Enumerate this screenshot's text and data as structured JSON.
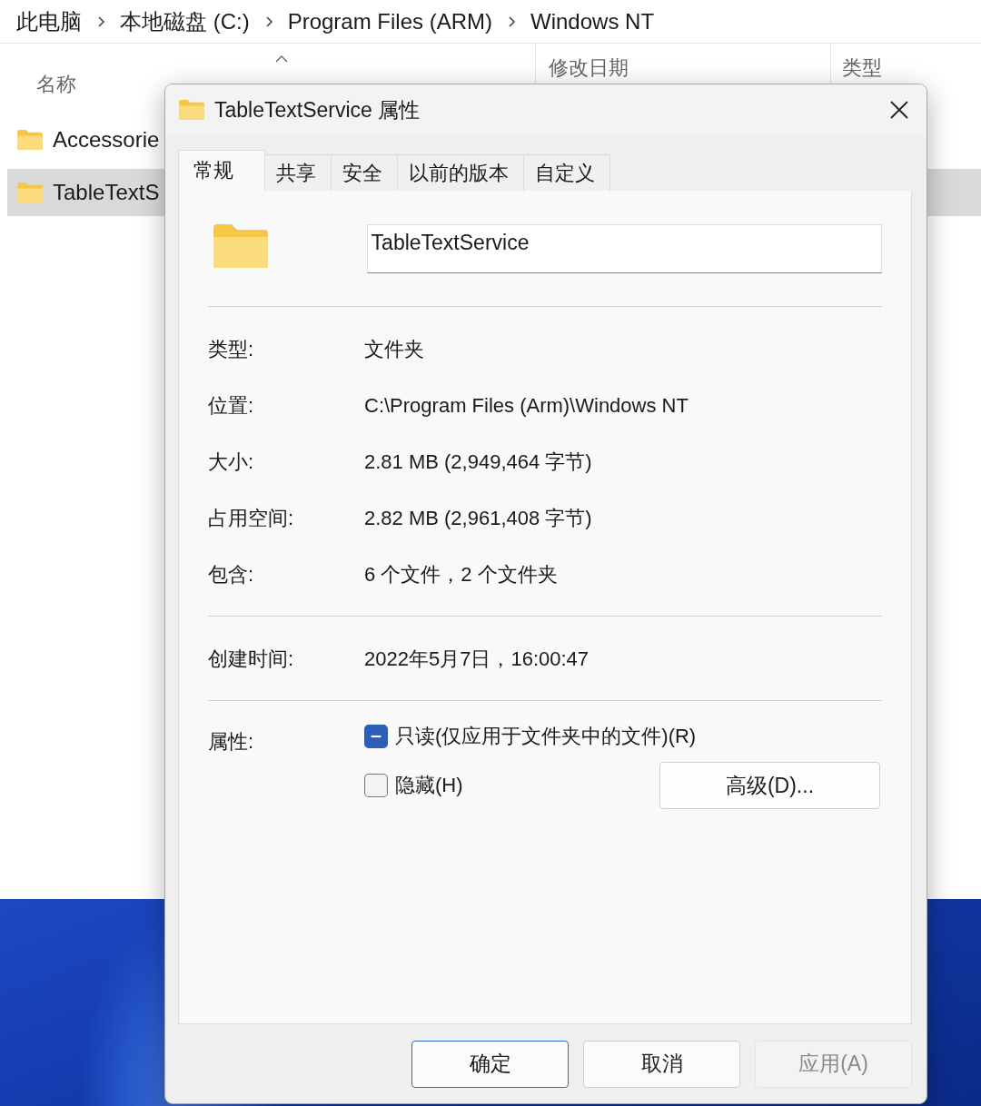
{
  "explorer": {
    "breadcrumb": [
      "此电脑",
      "本地磁盘 (C:)",
      "Program Files (ARM)",
      "Windows NT"
    ],
    "columns": [
      "名称",
      "修改日期",
      "类型"
    ],
    "rows": [
      {
        "name": "Accessorie",
        "selected": false
      },
      {
        "name": "TableTextS",
        "selected": true
      }
    ]
  },
  "dialog": {
    "title": "TableTextService 属性",
    "tabs": [
      {
        "label": "常规",
        "selected": true
      },
      {
        "label": "共享",
        "selected": false
      },
      {
        "label": "安全",
        "selected": false
      },
      {
        "label": "以前的版本",
        "selected": false
      },
      {
        "label": "自定义",
        "selected": false
      }
    ],
    "name_field": {
      "value": "TableTextService"
    },
    "properties": [
      {
        "label": "类型:",
        "value": "文件夹"
      },
      {
        "label": "位置:",
        "value": "C:\\Program Files (Arm)\\Windows NT"
      },
      {
        "label": "大小:",
        "value": "2.81 MB (2,949,464 字节)"
      },
      {
        "label": "占用空间:",
        "value": "2.82 MB (2,961,408 字节)"
      },
      {
        "label": "包含:",
        "value": "6 个文件，2 个文件夹"
      }
    ],
    "created": {
      "label": "创建时间:",
      "value": "2022年5月7日，16:00:47"
    },
    "attributes": {
      "label": "属性:",
      "checkboxes": [
        {
          "label": "只读(仅应用于文件夹中的文件)(R)",
          "checked": false,
          "mixed": true
        },
        {
          "label": "隐藏(H)",
          "checked": false,
          "mixed": false
        }
      ],
      "advanced_button": "高级(D)..."
    },
    "buttons": [
      {
        "label": "确定",
        "default": true,
        "disabled": false
      },
      {
        "label": "取消",
        "default": false,
        "disabled": false
      },
      {
        "label": "应用(A)",
        "default": false,
        "disabled": true
      }
    ]
  }
}
